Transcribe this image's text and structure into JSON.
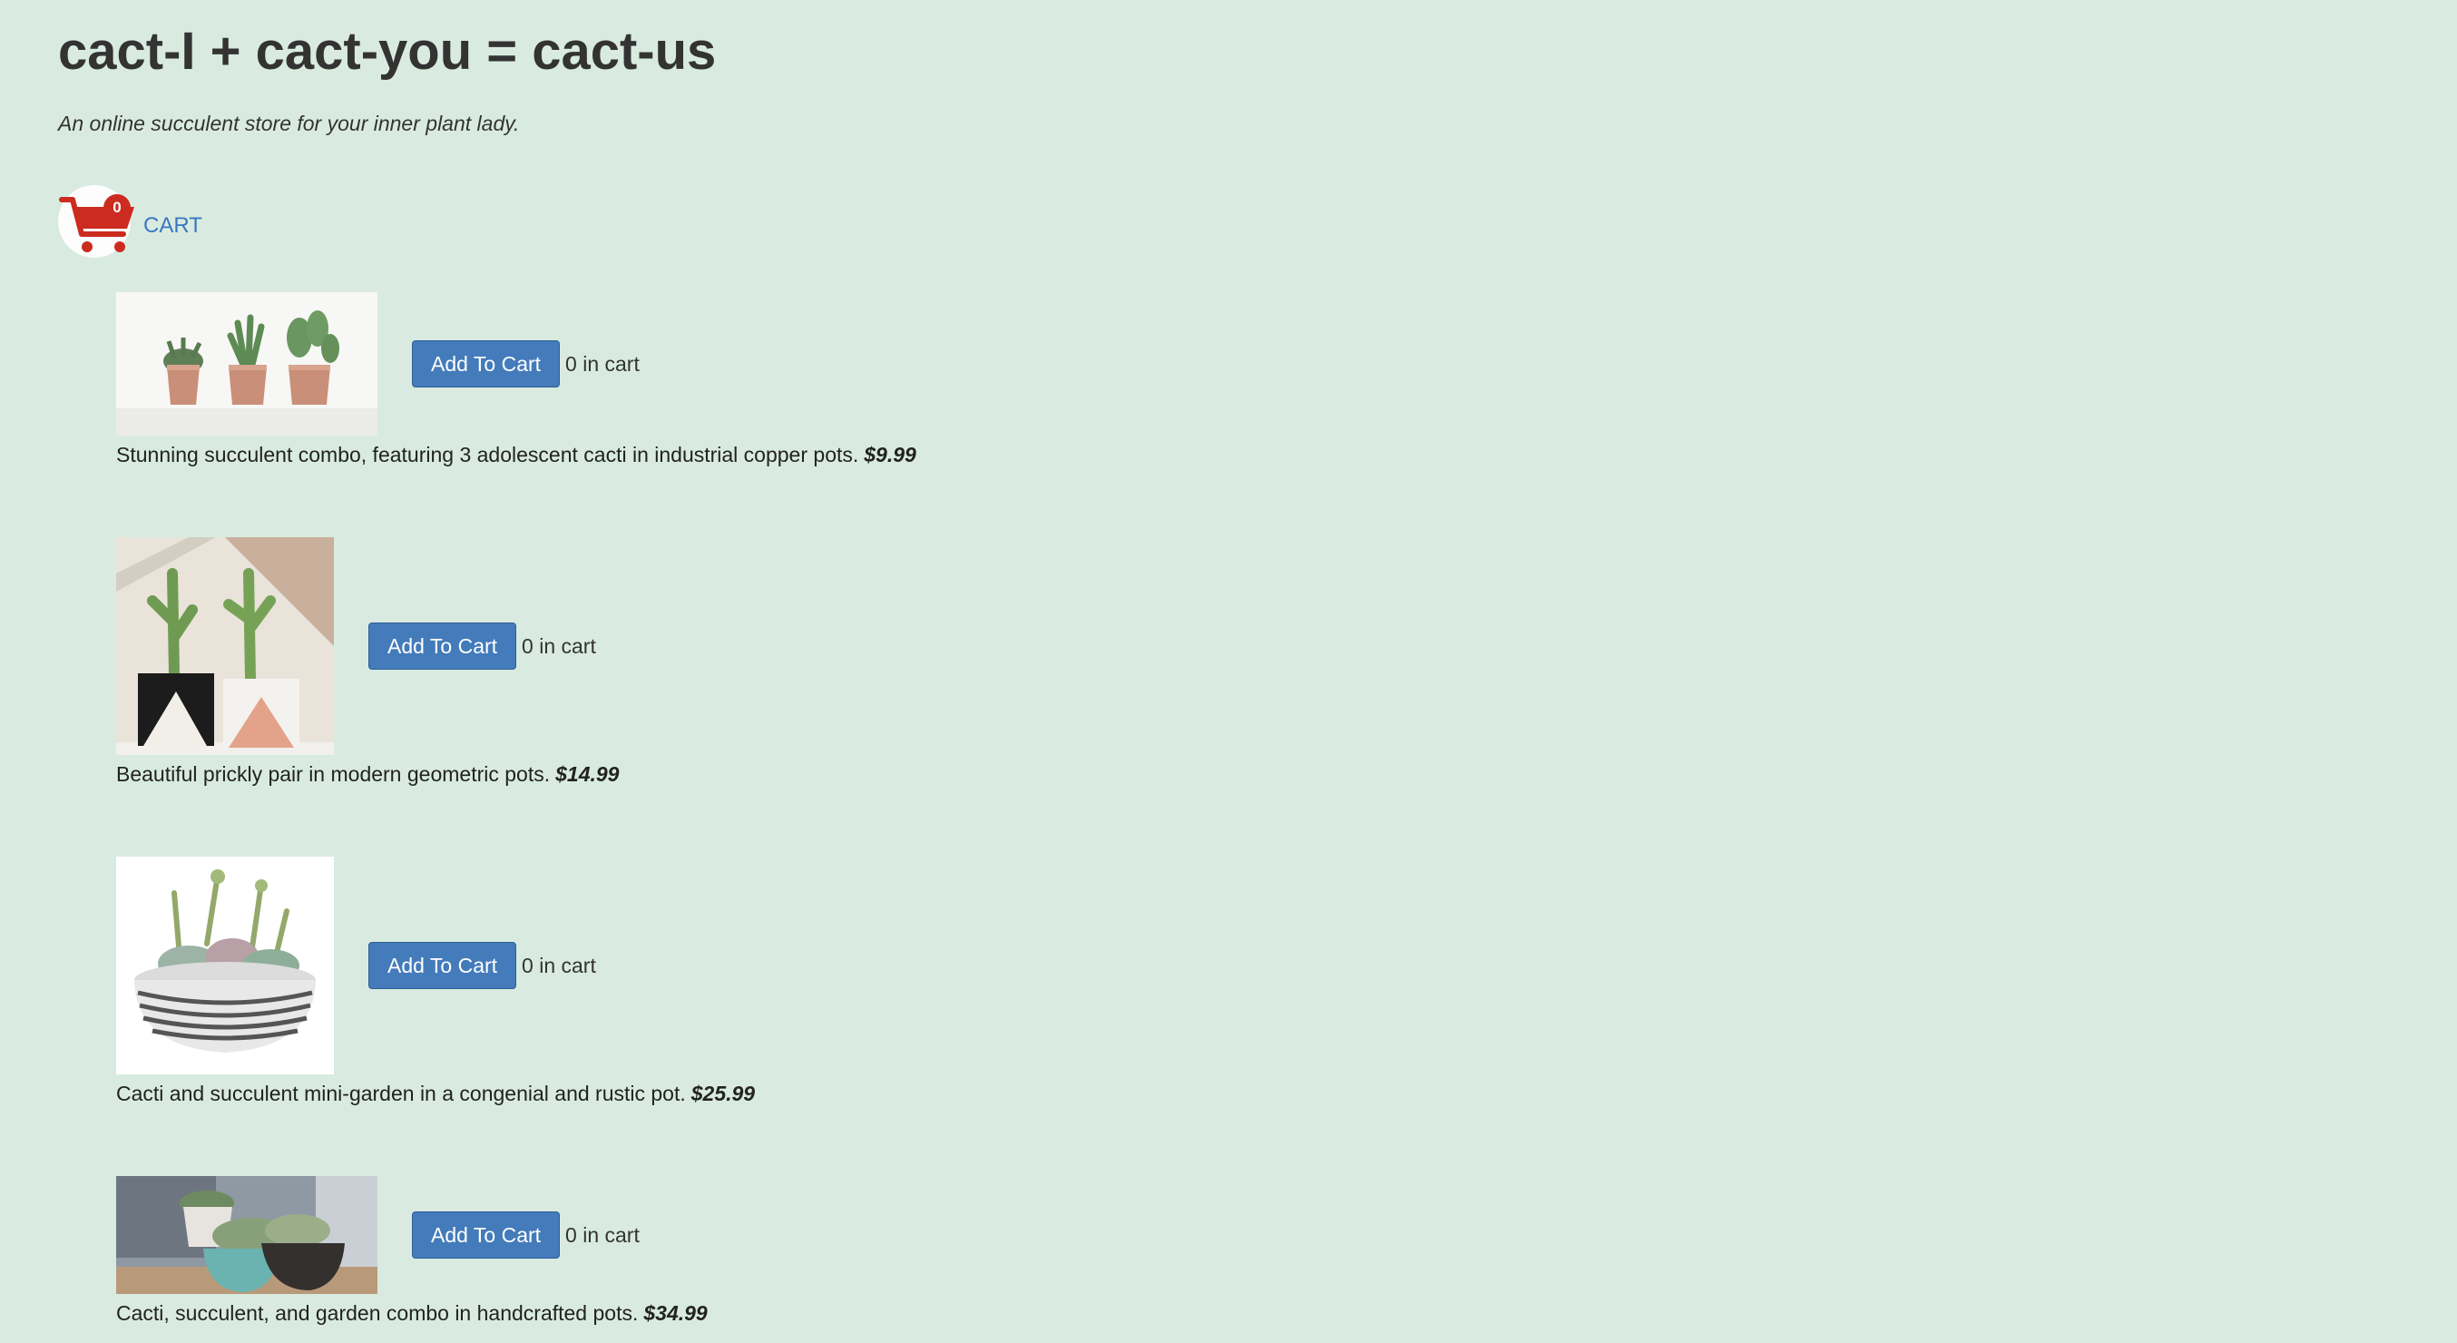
{
  "header": {
    "title": "cact-I + cact-you = cact-us",
    "tagline": "An online succulent store for your inner plant lady."
  },
  "cart": {
    "count": "0",
    "label": "CART",
    "icon": "shopping-cart-icon",
    "icon_color": "#cc2b1f"
  },
  "colors": {
    "background": "#d9ebe0",
    "button": "#447bba",
    "link": "#3a78c2"
  },
  "products": [
    {
      "image": "copper-pots-cacti-photo",
      "button_label": "Add To Cart",
      "in_cart": "0 in cart",
      "description": "Stunning succulent combo, featuring 3 adolescent cacti in industrial copper pots.",
      "price": "$9.99"
    },
    {
      "image": "geometric-pots-cacti-photo",
      "button_label": "Add To Cart",
      "in_cart": "0 in cart",
      "description": "Beautiful prickly pair in modern geometric pots.",
      "price": "$14.99"
    },
    {
      "image": "mini-garden-bowl-photo",
      "button_label": "Add To Cart",
      "in_cart": "0 in cart",
      "description": "Cacti and succulent mini-garden in a congenial and rustic pot.",
      "price": "$25.99"
    },
    {
      "image": "handcrafted-pots-combo-photo",
      "button_label": "Add To Cart",
      "in_cart": "0 in cart",
      "description": "Cacti, succulent, and garden combo in handcrafted pots.",
      "price": "$34.99"
    }
  ]
}
